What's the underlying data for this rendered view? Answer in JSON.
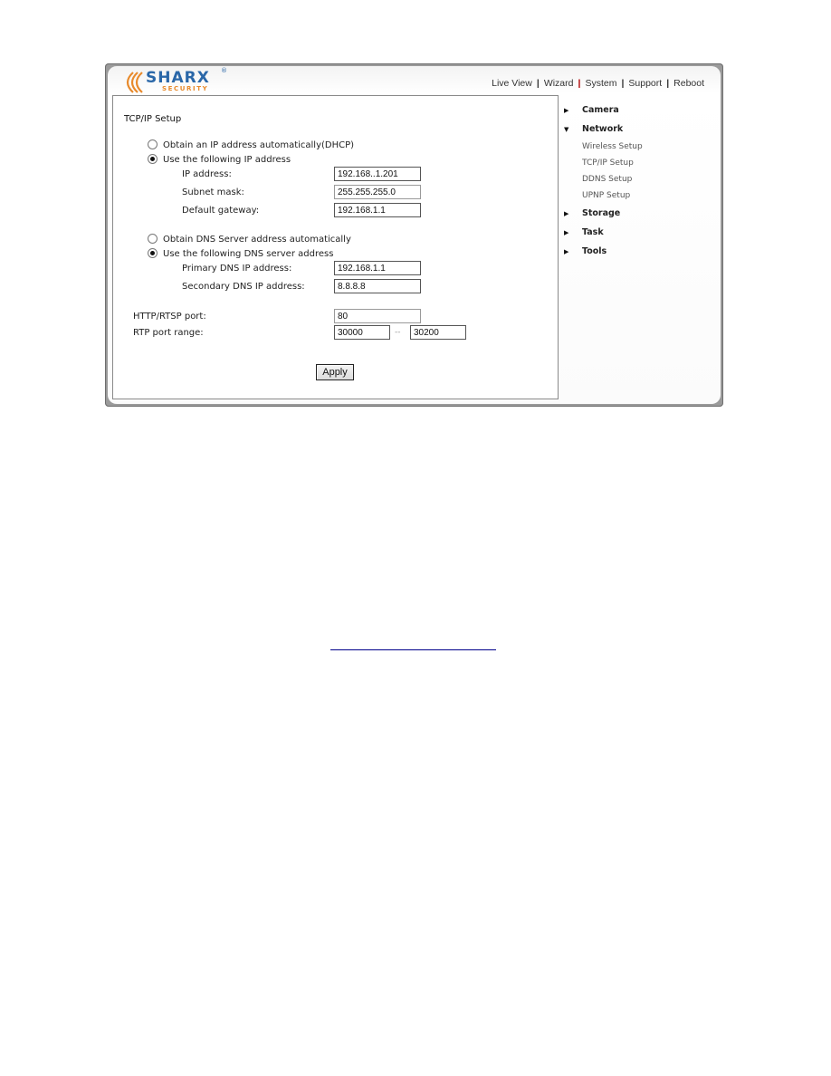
{
  "brand": {
    "name": "SHARX",
    "tagline": "SECURITY",
    "registered": "®",
    "colors": {
      "primary": "#2a67a8",
      "accent": "#e88a2c"
    }
  },
  "topnav": {
    "items": [
      "Live View",
      "Wizard",
      "System",
      "Support",
      "Reboot"
    ],
    "separator": "|"
  },
  "form": {
    "title": "TCP/IP Setup",
    "ip_mode": {
      "options": [
        {
          "label": "Obtain an IP address automatically(DHCP)",
          "selected": false
        },
        {
          "label": "Use the following IP address",
          "selected": true
        }
      ]
    },
    "ip_fields": [
      {
        "label": "IP address:",
        "value": "192.168..1.201"
      },
      {
        "label": "Subnet mask:",
        "value": "255.255.255.0"
      },
      {
        "label": "Default gateway:",
        "value": "192.168.1.1"
      }
    ],
    "dns_mode": {
      "options": [
        {
          "label": "Obtain DNS Server address automatically",
          "selected": false
        },
        {
          "label": "Use the following DNS server address",
          "selected": true
        }
      ]
    },
    "dns_fields": [
      {
        "label": "Primary DNS IP address:",
        "value": "192.168.1.1"
      },
      {
        "label": "Secondary DNS IP address:",
        "value": "8.8.8.8"
      }
    ],
    "http_port": {
      "label": "HTTP/RTSP port:",
      "value": "80"
    },
    "rtp_range": {
      "label": "RTP port range:",
      "from": "30000",
      "separator": "--",
      "to": "30200"
    },
    "apply_label": "Apply"
  },
  "sidebar": {
    "items": [
      {
        "label": "Camera",
        "expanded": false
      },
      {
        "label": "Network",
        "expanded": true,
        "children": [
          "Wireless Setup",
          "TCP/IP Setup",
          "DDNS Setup",
          "UPNP Setup"
        ]
      },
      {
        "label": "Storage",
        "expanded": false
      },
      {
        "label": "Task",
        "expanded": false
      },
      {
        "label": "Tools",
        "expanded": false
      }
    ],
    "icons": {
      "collapsed": "▶",
      "expanded": "▼"
    }
  }
}
